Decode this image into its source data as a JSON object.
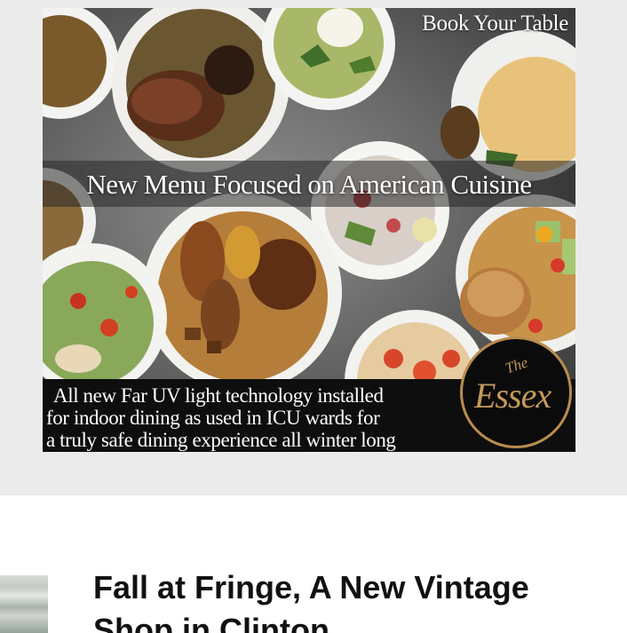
{
  "ad": {
    "book_label": "Book Your Table",
    "headline": "New Menu Focused on American Cuisine",
    "body_lines": [
      "All new Far UV light technology installed",
      "for indoor dining as used in ICU wards for",
      "a truly safe dining experience all winter long"
    ],
    "logo_the": "The",
    "logo_word": "Essex",
    "colors": {
      "logo_gold": "#c49a5c",
      "band": "#0e0e0e"
    }
  },
  "article": {
    "title": "Fall at Fringe, A New Vintage Shop in Clinton"
  }
}
